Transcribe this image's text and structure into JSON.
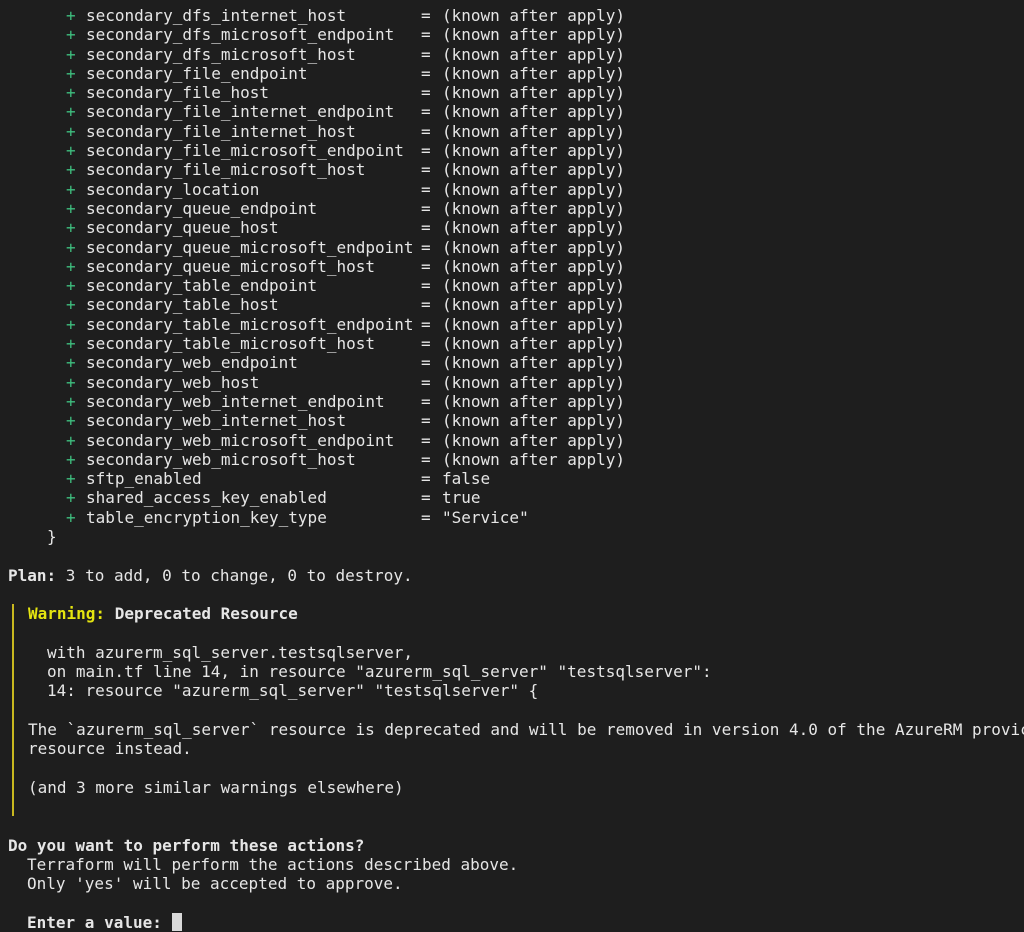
{
  "attributes": [
    {
      "name": "secondary_dfs_internet_host",
      "value": "(known after apply)"
    },
    {
      "name": "secondary_dfs_microsoft_endpoint",
      "value": "(known after apply)"
    },
    {
      "name": "secondary_dfs_microsoft_host",
      "value": "(known after apply)"
    },
    {
      "name": "secondary_file_endpoint",
      "value": "(known after apply)"
    },
    {
      "name": "secondary_file_host",
      "value": "(known after apply)"
    },
    {
      "name": "secondary_file_internet_endpoint",
      "value": "(known after apply)"
    },
    {
      "name": "secondary_file_internet_host",
      "value": "(known after apply)"
    },
    {
      "name": "secondary_file_microsoft_endpoint",
      "value": "(known after apply)"
    },
    {
      "name": "secondary_file_microsoft_host",
      "value": "(known after apply)"
    },
    {
      "name": "secondary_location",
      "value": "(known after apply)"
    },
    {
      "name": "secondary_queue_endpoint",
      "value": "(known after apply)"
    },
    {
      "name": "secondary_queue_host",
      "value": "(known after apply)"
    },
    {
      "name": "secondary_queue_microsoft_endpoint",
      "value": "(known after apply)"
    },
    {
      "name": "secondary_queue_microsoft_host",
      "value": "(known after apply)"
    },
    {
      "name": "secondary_table_endpoint",
      "value": "(known after apply)"
    },
    {
      "name": "secondary_table_host",
      "value": "(known after apply)"
    },
    {
      "name": "secondary_table_microsoft_endpoint",
      "value": "(known after apply)"
    },
    {
      "name": "secondary_table_microsoft_host",
      "value": "(known after apply)"
    },
    {
      "name": "secondary_web_endpoint",
      "value": "(known after apply)"
    },
    {
      "name": "secondary_web_host",
      "value": "(known after apply)"
    },
    {
      "name": "secondary_web_internet_endpoint",
      "value": "(known after apply)"
    },
    {
      "name": "secondary_web_internet_host",
      "value": "(known after apply)"
    },
    {
      "name": "secondary_web_microsoft_endpoint",
      "value": "(known after apply)"
    },
    {
      "name": "secondary_web_microsoft_host",
      "value": "(known after apply)"
    },
    {
      "name": "sftp_enabled",
      "value": "false"
    },
    {
      "name": "shared_access_key_enabled",
      "value": "true"
    },
    {
      "name": "table_encryption_key_type",
      "value": "\"Service\""
    }
  ],
  "symbols": {
    "plus": "+",
    "equals": "=",
    "close_brace": "}"
  },
  "plan": {
    "label": "Plan:",
    "summary": " 3 to add, 0 to change, 0 to destroy."
  },
  "warning": {
    "label": "Warning:",
    "title": " Deprecated Resource",
    "context_lines": [
      "with azurerm_sql_server.testsqlserver,",
      "on main.tf line 14, in resource \"azurerm_sql_server\" \"testsqlserver\":",
      "14: resource \"azurerm_sql_server\" \"testsqlserver\" {"
    ],
    "message_lines": [
      "The `azurerm_sql_server` resource is deprecated and will be removed in version 4.0 of the AzureRM provic",
      "resource instead."
    ],
    "more": "(and 3 more similar warnings elsewhere)"
  },
  "prompt": {
    "question": "Do you want to perform these actions?",
    "line1": "Terraform will perform the actions described above.",
    "line2": "Only 'yes' will be accepted to approve.",
    "input_label": "Enter a value: "
  },
  "colors": {
    "plus": "#3fbf7f",
    "warning": "#e5e510",
    "warning_bar": "#c8b81f",
    "background": "#1e1e1e"
  }
}
